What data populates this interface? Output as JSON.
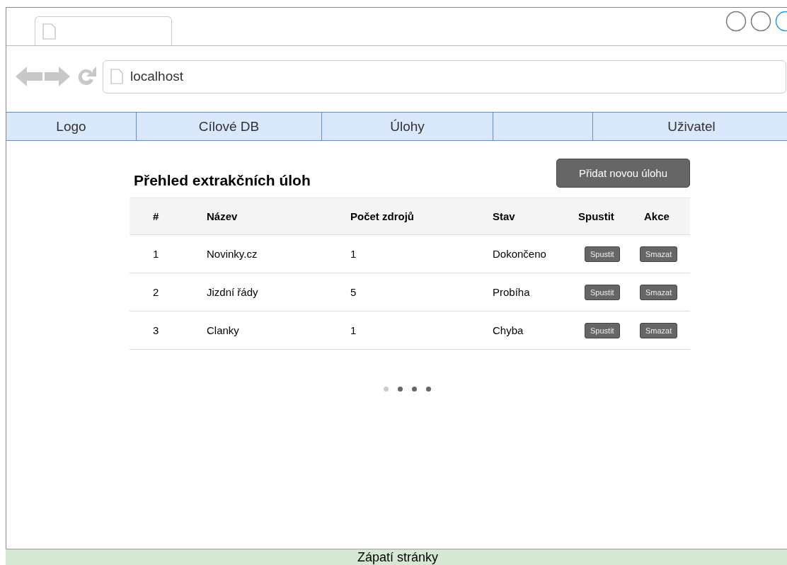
{
  "browser": {
    "address": "localhost"
  },
  "nav": [
    {
      "kind": "item",
      "label": "Logo"
    },
    {
      "kind": "item",
      "label": "Cílové DB"
    },
    {
      "kind": "item",
      "label": "Úlohy"
    },
    {
      "kind": "blank"
    },
    {
      "kind": "item",
      "label": "Uživatel"
    }
  ],
  "page_title": "Přehled extrakčních úloh",
  "add_button": "Přidat novou úlohu",
  "table": {
    "columns": [
      "#",
      "Název",
      "Počet zdrojů",
      "Stav",
      "Spustit",
      "Akce"
    ],
    "rows": [
      {
        "number": "1",
        "name": "Novinky.cz",
        "sources": "1",
        "status": "Dokončeno",
        "run": "Spustit",
        "action": "Smazat"
      },
      {
        "number": "2",
        "name": "Jizdní řády",
        "sources": "5",
        "status": "Probíha",
        "run": "Spustit",
        "action": "Smazat"
      },
      {
        "number": "3",
        "name": "Clanky",
        "sources": "1",
        "status": "Chyba",
        "run": "Spustit",
        "action": "Smazat"
      }
    ]
  },
  "pagination": [
    {
      "selected": true
    },
    {
      "selected": false
    },
    {
      "selected": false
    },
    {
      "selected": false
    }
  ],
  "footer": "Zápatí stránky"
}
